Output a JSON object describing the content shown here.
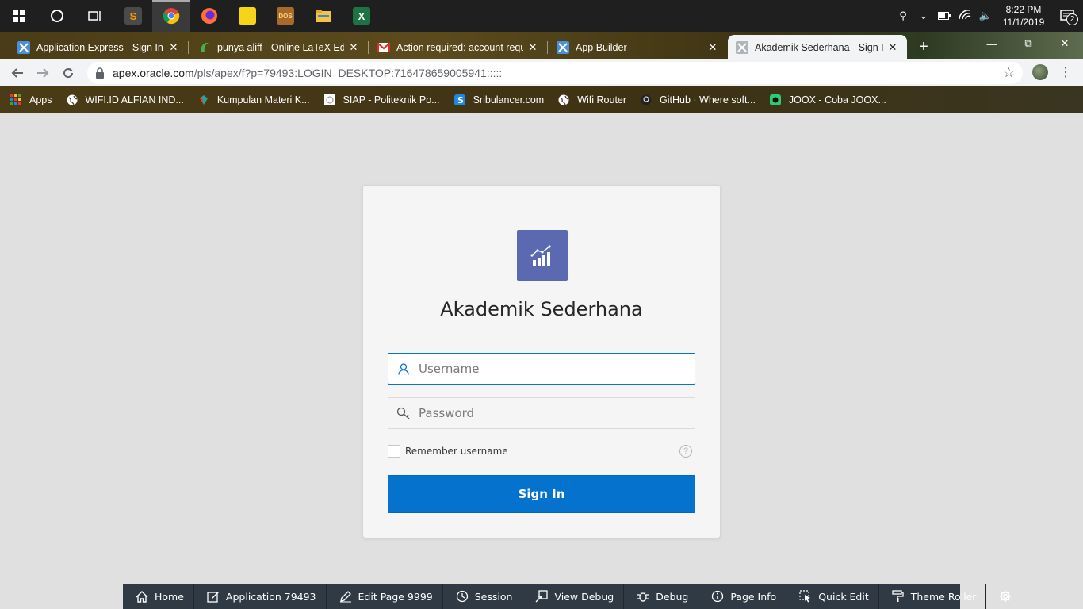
{
  "taskbar": {
    "apps": [
      {
        "name": "sublime-text",
        "color": "#4a4a4a",
        "glyph": "S",
        "glyph_color": "#ff9800"
      },
      {
        "name": "chrome",
        "color": "#3a3a3a",
        "active": true
      },
      {
        "name": "firefox",
        "color": "#ff7139"
      },
      {
        "name": "sticky-notes",
        "color": "#f7d417"
      },
      {
        "name": "dosbox",
        "color": "#a86a2a"
      },
      {
        "name": "file-explorer",
        "color": "#f4c542"
      },
      {
        "name": "excel",
        "color": "#1d7344",
        "glyph": "X"
      }
    ],
    "clock_time": "8:22 PM",
    "clock_date": "11/1/2019",
    "notification_count": "2"
  },
  "tabs": [
    {
      "title": "Application Express - Sign In",
      "icon": "apex-icon"
    },
    {
      "title": "punya aliff - Online LaTeX Editor",
      "icon": "overleaf-icon"
    },
    {
      "title": "Action required: account request",
      "icon": "gmail-icon"
    },
    {
      "title": "App Builder",
      "icon": "apex-icon"
    },
    {
      "title": "Akademik Sederhana - Sign In",
      "icon": "apex-icon",
      "active": true
    }
  ],
  "address": {
    "host": "apex.oracle.com",
    "path": "/pls/apex/f?p=79493:LOGIN_DESKTOP:716478659005941:::::"
  },
  "bookmarks": [
    {
      "label": "Apps",
      "icon": "apps-grid-icon"
    },
    {
      "label": "WIFI.ID ALFIAN IND...",
      "icon": "globe-icon"
    },
    {
      "label": "Kumpulan Materi K...",
      "icon": "gem-icon"
    },
    {
      "label": "SIAP - Politeknik Po...",
      "icon": "siap-icon"
    },
    {
      "label": "Sribulancer.com",
      "icon": "sribulancer-icon"
    },
    {
      "label": "Wifi Router",
      "icon": "globe-icon"
    },
    {
      "label": "GitHub · Where soft...",
      "icon": "github-icon"
    },
    {
      "label": "JOOX - Coba JOOX...",
      "icon": "joox-icon"
    }
  ],
  "login": {
    "app_title": "Akademik Sederhana",
    "username_placeholder": "Username",
    "password_placeholder": "Password",
    "remember_label": "Remember username",
    "help_glyph": "?",
    "sign_in_label": "Sign In",
    "accent": "#0572ce",
    "logo_color": "#5a69b0"
  },
  "devbar": [
    {
      "label": "Home",
      "icon": "home-icon"
    },
    {
      "label": "Application 79493",
      "icon": "edit-app-icon"
    },
    {
      "label": "Edit Page 9999",
      "icon": "edit-page-icon"
    },
    {
      "label": "Session",
      "icon": "clock-icon"
    },
    {
      "label": "View Debug",
      "icon": "view-debug-icon"
    },
    {
      "label": "Debug",
      "icon": "bug-icon"
    },
    {
      "label": "Page Info",
      "icon": "info-icon"
    },
    {
      "label": "Quick Edit",
      "icon": "quick-edit-icon"
    },
    {
      "label": "Theme Roller",
      "icon": "paint-roller-icon"
    },
    {
      "label": "",
      "icon": "gear-icon"
    }
  ]
}
